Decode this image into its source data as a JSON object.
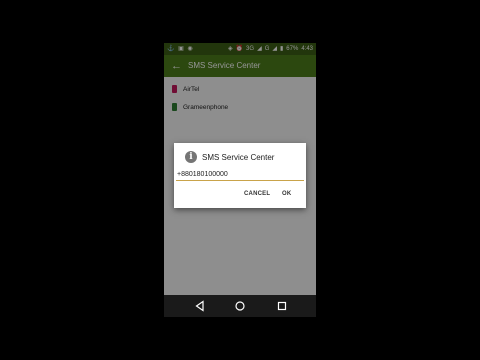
{
  "status_bar": {
    "battery_percent": "67%",
    "time": "4:43",
    "network_label": "3G",
    "network_label_2": "G"
  },
  "app_bar": {
    "title": "SMS Service Center"
  },
  "carriers": [
    {
      "label": "AirTel",
      "color": "#c2185b"
    },
    {
      "label": "Grameenphone",
      "color": "#2e7d32"
    }
  ],
  "dialog": {
    "title": "SMS Service Center",
    "input_value": "+880180100000",
    "cancel_label": "CANCEL",
    "ok_label": "OK"
  },
  "colors": {
    "accent": "#4d7d1b",
    "status_bar": "#3b5e15"
  }
}
